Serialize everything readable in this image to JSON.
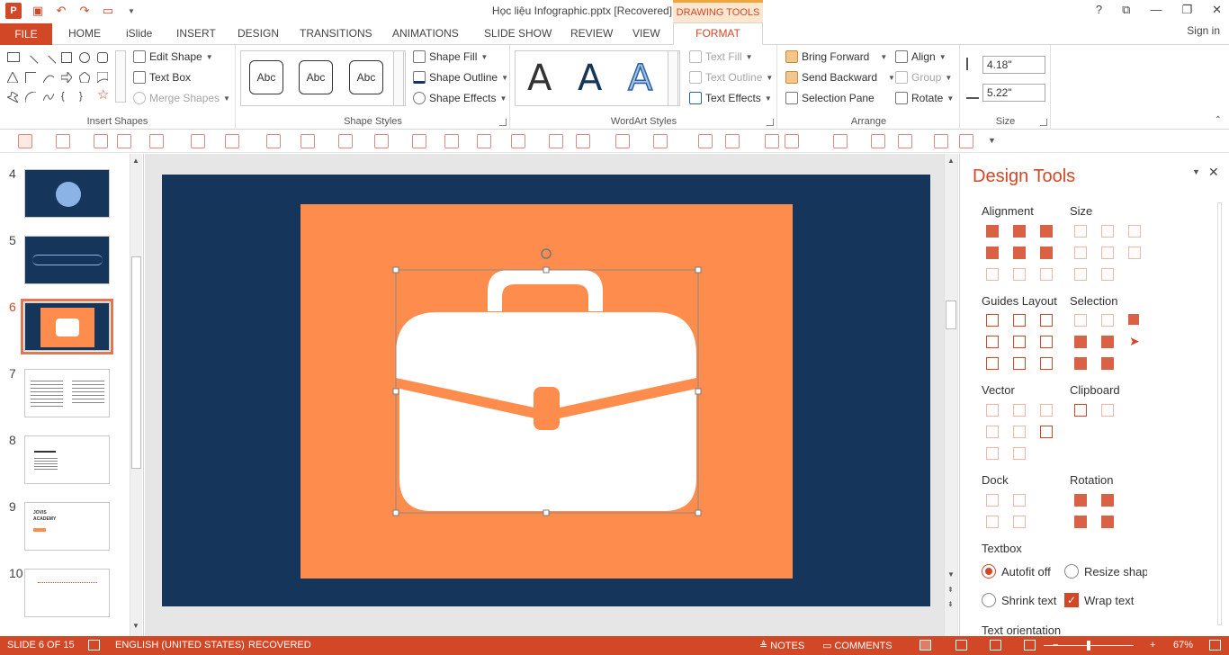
{
  "window": {
    "title": "Học liệu Infographic.pptx [Recovered] - PowerPoint",
    "context_tab": "DRAWING TOOLS",
    "help": "?",
    "ribbon_display": "⧉",
    "minimize": "—",
    "restore": "❐",
    "close": "✕"
  },
  "tabs": {
    "file": "FILE",
    "home": "HOME",
    "islide": "iSlide",
    "insert": "INSERT",
    "design": "DESIGN",
    "transitions": "TRANSITIONS",
    "animations": "ANIMATIONS",
    "slideshow": "SLIDE SHOW",
    "review": "REVIEW",
    "view": "VIEW",
    "format": "FORMAT",
    "signin": "Sign in"
  },
  "ribbon": {
    "insert_shapes": {
      "label": "Insert Shapes",
      "edit_shape": "Edit Shape",
      "text_box": "Text Box",
      "merge_shapes": "Merge Shapes"
    },
    "shape_styles": {
      "label": "Shape Styles",
      "style1": "Abc",
      "style2": "Abc",
      "style3": "Abc",
      "shape_fill": "Shape Fill",
      "shape_outline": "Shape Outline",
      "shape_effects": "Shape Effects"
    },
    "wordart": {
      "label": "WordArt Styles",
      "a1": "A",
      "a2": "A",
      "a3": "A",
      "text_fill": "Text Fill",
      "text_outline": "Text Outline",
      "text_effects": "Text Effects"
    },
    "arrange": {
      "label": "Arrange",
      "bring_forward": "Bring Forward",
      "send_backward": "Send Backward",
      "selection_pane": "Selection Pane",
      "align": "Align",
      "group": "Group",
      "rotate": "Rotate"
    },
    "size": {
      "label": "Size",
      "height": "4.18\"",
      "width": "5.22\""
    }
  },
  "slides": [
    {
      "num": "4"
    },
    {
      "num": "5"
    },
    {
      "num": "6"
    },
    {
      "num": "7"
    },
    {
      "num": "8"
    },
    {
      "num": "9",
      "text1": "JOVIS",
      "text2": "ACADEMY"
    },
    {
      "num": "10"
    }
  ],
  "design_tools": {
    "title": "Design Tools",
    "alignment": "Alignment",
    "size": "Size",
    "guides_layout": "Guides Layout",
    "selection": "Selection",
    "vector": "Vector",
    "clipboard": "Clipboard",
    "dock": "Dock",
    "rotation": "Rotation",
    "textbox": "Textbox",
    "autofit_off": "Autofit off",
    "resize_shape": "Resize shape",
    "shrink_text": "Shrink text",
    "wrap_text": "Wrap text",
    "text_more": "Text orientation"
  },
  "status": {
    "slide": "SLIDE 6 OF 15",
    "language": "ENGLISH (UNITED STATES)",
    "recovered": "RECOVERED",
    "notes": "NOTES",
    "comments": "COMMENTS",
    "zoom": "67%"
  },
  "colors": {
    "accent": "#d24726",
    "slide_bg": "#16355b",
    "orange": "#fe8c4c",
    "briefcase": "#ffffff"
  }
}
